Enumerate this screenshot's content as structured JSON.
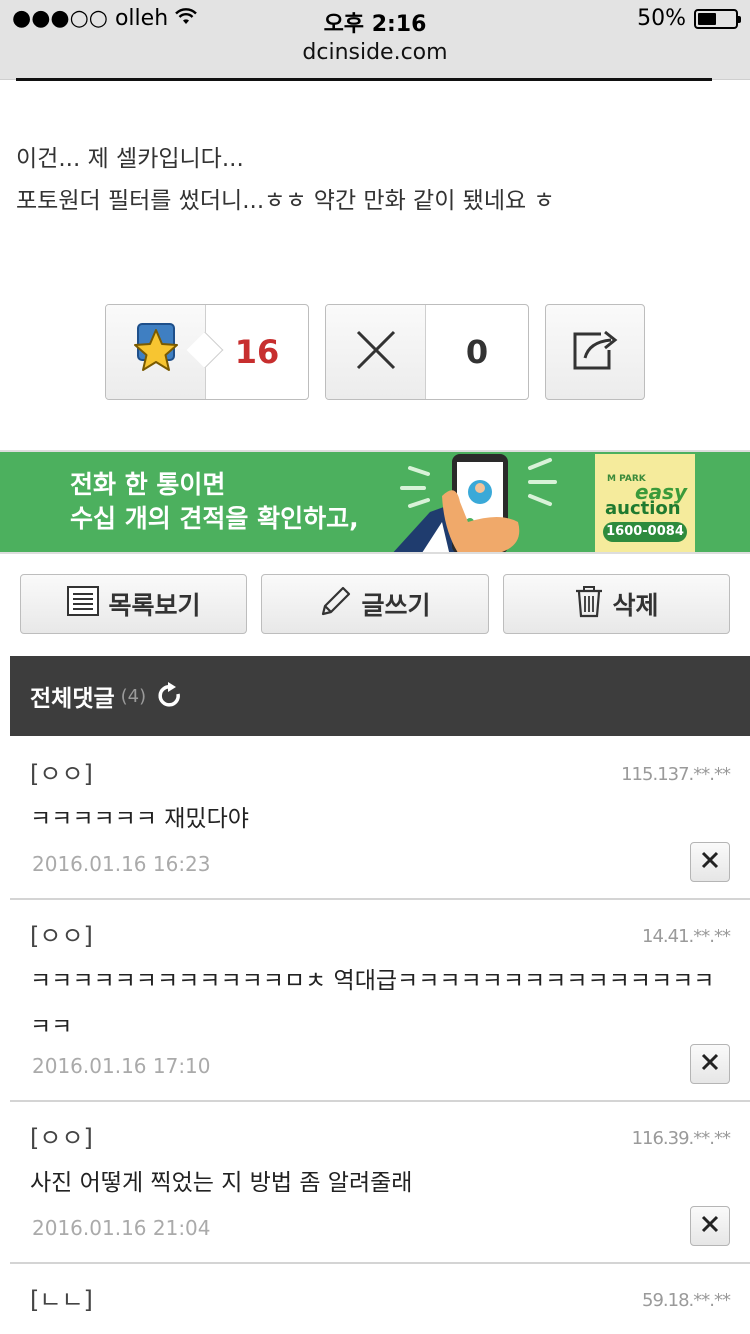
{
  "status_bar": {
    "carrier": "●●●○○ olleh",
    "time": "오후 2:16",
    "battery": "50%",
    "battery_level": 0.5,
    "url": "dcinside.com"
  },
  "post": {
    "lines": [
      "이건... 제 셀카입니다...",
      "포토원더 필터를 썼더니...ㅎㅎ 약간 만화 같이 됐네요 ㅎ"
    ]
  },
  "votes": {
    "recommend_count": "16",
    "not_recommend_count": "0"
  },
  "ad": {
    "line1": "전화 한 통이면",
    "line2": "수십 개의 견적을 확인하고,",
    "logo_small": "M PARK",
    "logo_easy": "easy",
    "logo_auction": "auction",
    "phone": "1600-0084",
    "bg_color": "#4cb05e"
  },
  "actions": {
    "list_label": "목록보기",
    "write_label": "글쓰기",
    "delete_label": "삭제"
  },
  "comments_header": {
    "title": "전체댓글",
    "count": "(4)"
  },
  "comments": [
    {
      "author": "[ㅇㅇ]",
      "ip": "115.137.**.**",
      "body": "ㅋㅋㅋㅋㅋㅋ 재밌다야",
      "date": "2016.01.16 16:23"
    },
    {
      "author": "[ㅇㅇ]",
      "ip": "14.41.**.**",
      "body": "ㅋㅋㅋㅋㅋㅋㅋㅋㅋㅋㅋㅋㅁㅊ 역대급ㅋㅋㅋㅋㅋㅋㅋㅋㅋㅋㅋㅋㅋㅋㅋㅋㅋ",
      "date": "2016.01.16 17:10"
    },
    {
      "author": "[ㅇㅇ]",
      "ip": "116.39.**.**",
      "body": "사진 어떻게 찍었는 지 방법 좀 알려줄래",
      "date": "2016.01.16 21:04"
    },
    {
      "author": "[ㄴㄴ]",
      "ip": "59.18.**.**",
      "body": "",
      "date": ""
    }
  ]
}
